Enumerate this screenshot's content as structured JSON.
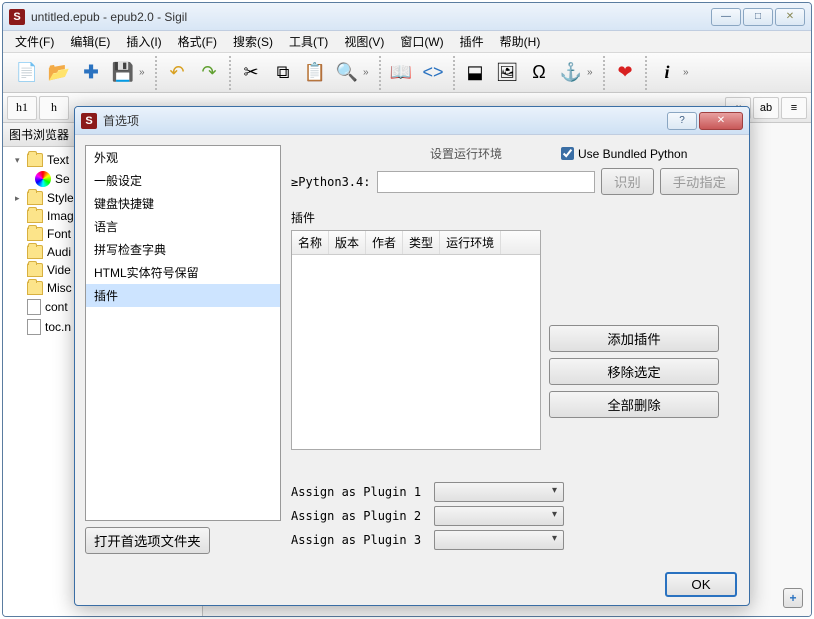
{
  "window": {
    "title": "untitled.epub - epub2.0 - Sigil",
    "app_char": "S"
  },
  "menu": [
    "文件(F)",
    "编辑(E)",
    "插入(I)",
    "格式(F)",
    "搜索(S)",
    "工具(T)",
    "视图(V)",
    "窗口(W)",
    "插件",
    "帮助(H)"
  ],
  "headings": [
    "h1",
    "h"
  ],
  "heading_right": [
    "∝",
    "ab",
    "≡"
  ],
  "sidebar": {
    "title": "图书浏览器",
    "items": [
      {
        "label": "Text",
        "type": "folder",
        "expanded": true
      },
      {
        "label": "Se",
        "type": "section",
        "indent": true
      },
      {
        "label": "Style",
        "type": "folder"
      },
      {
        "label": "Imag",
        "type": "folder"
      },
      {
        "label": "Font",
        "type": "folder"
      },
      {
        "label": "Audi",
        "type": "folder"
      },
      {
        "label": "Vide",
        "type": "folder"
      },
      {
        "label": "Misc",
        "type": "folder"
      },
      {
        "label": "cont",
        "type": "file"
      },
      {
        "label": "toc.n",
        "type": "file"
      }
    ]
  },
  "dialog": {
    "title": "首选项",
    "categories": [
      "外观",
      "一般设定",
      "键盘快捷键",
      "语言",
      "拼写检查字典",
      "HTML实体符号保留",
      "插件"
    ],
    "selected": 6,
    "open_folder": "打开首选项文件夹",
    "env_label": "设置运行环境",
    "use_bundled": "Use Bundled Python",
    "use_bundled_checked": true,
    "python_label": "≥Python3.4:",
    "identify_btn": "识别",
    "manual_btn": "手动指定",
    "group_plugins": "插件",
    "table_headers": [
      "名称",
      "版本",
      "作者",
      "类型",
      "运行环境"
    ],
    "add_plugin": "添加插件",
    "remove_selected": "移除选定",
    "remove_all": "全部删除",
    "assigns": [
      {
        "label": "Assign as Plugin 1"
      },
      {
        "label": "Assign as Plugin 2"
      },
      {
        "label": "Assign as Plugin 3"
      }
    ],
    "ok": "OK"
  }
}
